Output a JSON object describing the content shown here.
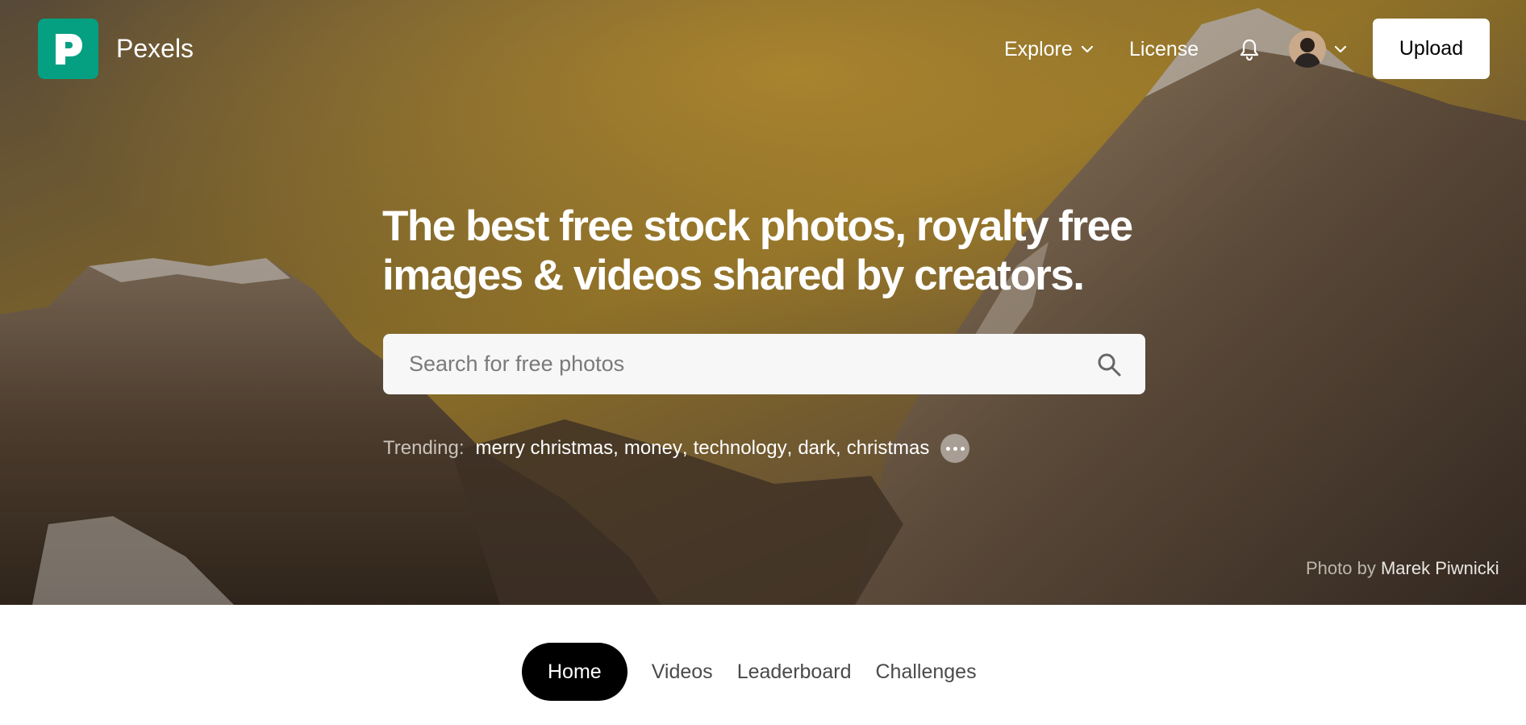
{
  "header": {
    "brand": "Pexels",
    "nav": {
      "explore_label": "Explore",
      "license_label": "License"
    },
    "upload_label": "Upload",
    "brand_color": "#05a081"
  },
  "hero": {
    "headline_line1": "The best free stock photos, royalty free",
    "headline_line2": "images & videos shared by creators.",
    "search": {
      "placeholder": "Search for free photos",
      "value": ""
    },
    "trending": {
      "label": "Trending:",
      "terms": [
        "merry christmas",
        "money",
        "technology",
        "dark",
        "christmas"
      ]
    },
    "credit": {
      "prefix": "Photo by",
      "photographer": "Marek Piwnicki"
    }
  },
  "tabs": [
    {
      "label": "Home",
      "active": true
    },
    {
      "label": "Videos",
      "active": false
    },
    {
      "label": "Leaderboard",
      "active": false
    },
    {
      "label": "Challenges",
      "active": false
    }
  ],
  "icons": {
    "logo": "pexels-logo-icon",
    "explore_chevron": "chevron-down-icon",
    "notifications": "bell-icon",
    "avatar_chevron": "chevron-down-icon",
    "search": "search-icon",
    "more": "more-dots-icon"
  }
}
